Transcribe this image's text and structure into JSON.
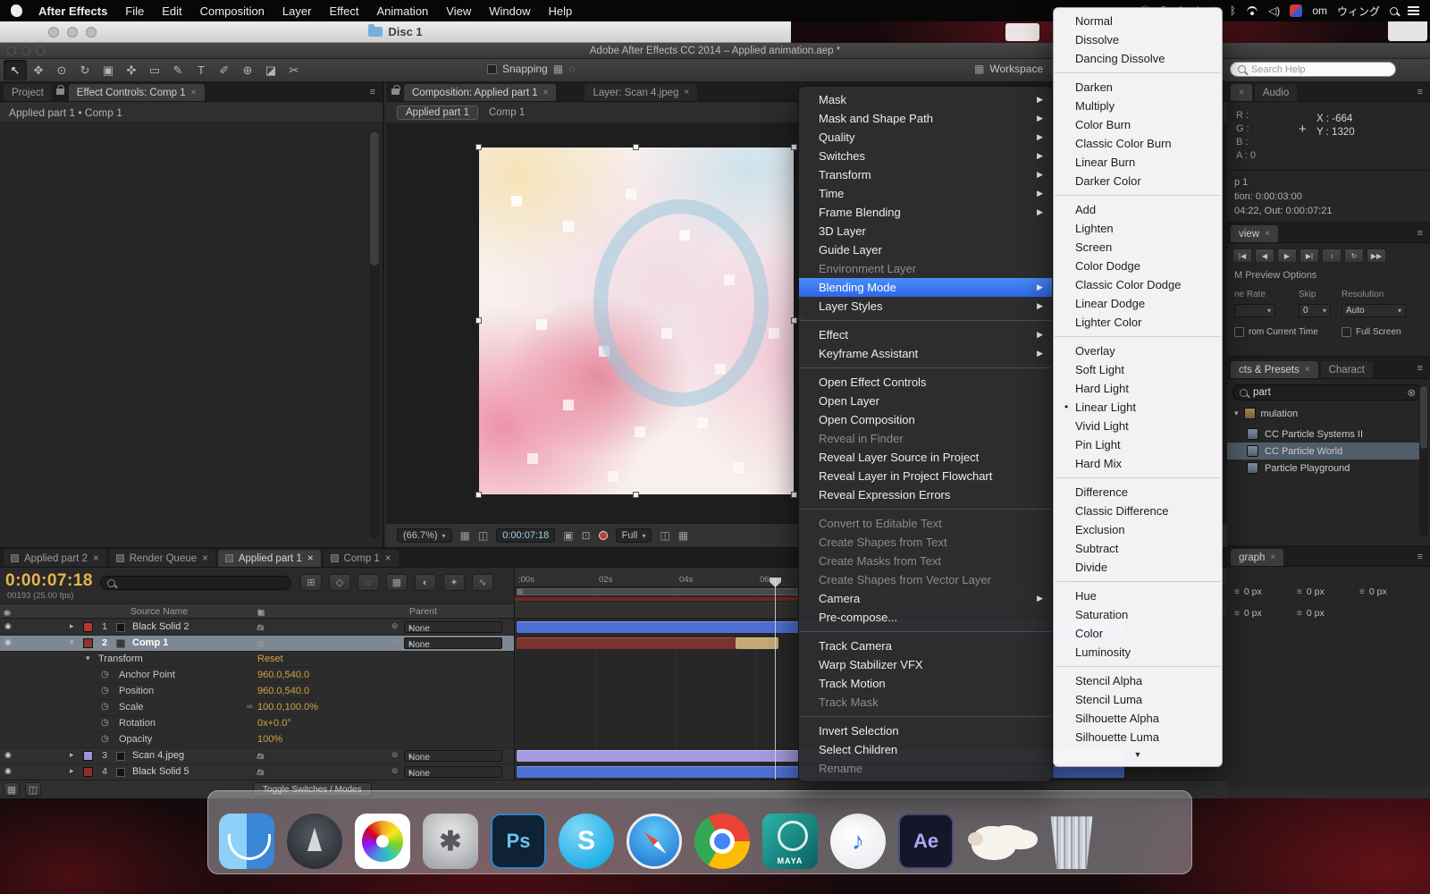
{
  "colors": {
    "menu_highlight": "#2c67e8",
    "value_text": "#d1a140",
    "timeline_timecode": "#e5b648",
    "comp_timecode": "#9fd0e8",
    "label_red": "#b03a30",
    "label_dark_red": "#8c2f2a",
    "label_purple": "#9e95d8",
    "selected_row": "#7e8893"
  },
  "icons": {
    "close": "×",
    "menu": "≡",
    "arrow_down": "▾",
    "arrow_right": "▸",
    "bullet": "•",
    "eye": "◉",
    "stopwatch": "◷",
    "link": "∞",
    "parent_link": "⊚",
    "clear": "⊗",
    "grid": "▦",
    "grid2": "◫",
    "camera": "▣",
    "snapshot": "⊡",
    "crumb_sep": "▸",
    "cross": "+",
    "scroll_down": "▼",
    "twirl_open": "▾",
    "twirl_closed": "▸",
    "comp_icon": "▣"
  },
  "menubar": {
    "app_name": "After Effects",
    "items": [
      {
        "label": "File"
      },
      {
        "label": "Edit"
      },
      {
        "label": "Composition"
      },
      {
        "label": "Layer"
      },
      {
        "label": "Effect"
      },
      {
        "label": "Animation"
      },
      {
        "label": "View"
      },
      {
        "label": "Window"
      },
      {
        "label": "Help"
      }
    ],
    "status": {
      "badge_1": "5",
      "badge_2": "1",
      "icon_sync": "↻",
      "icon_bt": "ᛒ",
      "text_fragment": "om",
      "ime_label": "ウィング"
    }
  },
  "finder_window": {
    "title": "Disc 1"
  },
  "ae_window": {
    "title": "Adobe After Effects CC 2014 – Applied animation.aep *"
  },
  "toolbar": {
    "tools": [
      {
        "_name": "selection-tool",
        "glyph": "↖",
        "active": true
      },
      {
        "_name": "hand-tool",
        "glyph": "✥"
      },
      {
        "_name": "zoom-tool",
        "glyph": "⊙"
      },
      {
        "_name": "rotation-tool",
        "glyph": "↻"
      },
      {
        "_name": "camera-tool",
        "glyph": "▣"
      },
      {
        "_name": "pan-behind-tool",
        "glyph": "✜"
      },
      {
        "_name": "shape-tool",
        "glyph": "▭"
      },
      {
        "_name": "pen-tool",
        "glyph": "✎"
      },
      {
        "_name": "type-tool",
        "glyph": "T"
      },
      {
        "_name": "brush-tool",
        "glyph": "✐"
      },
      {
        "_name": "clone-stamp-tool",
        "glyph": "⊕"
      },
      {
        "_name": "eraser-tool",
        "glyph": "◪"
      },
      {
        "_name": "roto-brush-tool",
        "glyph": "✂"
      }
    ],
    "snapping_label": "Snapping",
    "snap_icon_1": "▦",
    "snap_icon_2": "◌",
    "workspace_icon": "▦",
    "workspace_label": "Workspace",
    "search_help_placeholder": "Search Help"
  },
  "project_panel": {
    "tab_project": "Project",
    "tab_effect_controls": "Effect Controls: Comp 1",
    "breadcrumb": "Applied part 1 • Comp 1"
  },
  "comp_panel": {
    "tab_composition": "Composition: Applied part 1",
    "tab_layer": "Layer: Scan 4.jpeg",
    "crumb_comp": "Applied part 1",
    "crumb_parent": "Comp 1",
    "zoom_value": "(66.7%)",
    "timecode": "0:00:07:18",
    "resolution_value": "Full"
  },
  "context_menu": {
    "items": [
      {
        "label": "Mask",
        "submenu": true
      },
      {
        "label": "Mask and Shape Path",
        "submenu": true
      },
      {
        "label": "Quality",
        "submenu": true
      },
      {
        "label": "Switches",
        "submenu": true
      },
      {
        "label": "Transform",
        "submenu": true
      },
      {
        "label": "Time",
        "submenu": true
      },
      {
        "label": "Frame Blending",
        "submenu": true
      },
      {
        "label": "3D Layer"
      },
      {
        "label": "Guide Layer"
      },
      {
        "label": "Environment Layer",
        "disabled": true
      },
      {
        "label": "Blending Mode",
        "submenu": true,
        "highlighted": true,
        "_name": "context-menu-item-blending-mode"
      },
      {
        "label": "Layer Styles",
        "submenu": true
      },
      {
        "is_sep": true,
        "_name": "menu-separator",
        "_inter": false
      },
      {
        "label": "Effect",
        "submenu": true
      },
      {
        "label": "Keyframe Assistant",
        "submenu": true
      },
      {
        "is_sep": true,
        "_name": "menu-separator",
        "_inter": false
      },
      {
        "label": "Open Effect Controls"
      },
      {
        "label": "Open Layer"
      },
      {
        "label": "Open Composition"
      },
      {
        "label": "Reveal in Finder",
        "disabled": true
      },
      {
        "label": "Reveal Layer Source in Project"
      },
      {
        "label": "Reveal Layer in Project Flowchart"
      },
      {
        "label": "Reveal Expression Errors"
      },
      {
        "is_sep": true,
        "_name": "menu-separator",
        "_inter": false
      },
      {
        "label": "Convert to Editable Text",
        "disabled": true
      },
      {
        "label": "Create Shapes from Text",
        "disabled": true
      },
      {
        "label": "Create Masks from Text",
        "disabled": true
      },
      {
        "label": "Create Shapes from Vector Layer",
        "disabled": true
      },
      {
        "label": "Camera",
        "submenu": true
      },
      {
        "label": "Pre-compose..."
      },
      {
        "is_sep": true,
        "_name": "menu-separator",
        "_inter": false
      },
      {
        "label": "Track Camera"
      },
      {
        "label": "Warp Stabilizer VFX"
      },
      {
        "label": "Track Motion"
      },
      {
        "label": "Track Mask",
        "disabled": true
      },
      {
        "is_sep": true,
        "_name": "menu-separator",
        "_inter": false
      },
      {
        "label": "Invert Selection"
      },
      {
        "label": "Select Children"
      },
      {
        "label": "Rename",
        "disabled": true
      }
    ]
  },
  "blend_submenu": {
    "scroll_hint": "▼",
    "items": [
      {
        "label": "Normal"
      },
      {
        "label": "Dissolve"
      },
      {
        "label": "Dancing Dissolve"
      },
      {
        "is_sep": true,
        "_name": "menu-separator",
        "_inter": false
      },
      {
        "label": "Darken"
      },
      {
        "label": "Multiply"
      },
      {
        "label": "Color Burn"
      },
      {
        "label": "Classic Color Burn"
      },
      {
        "label": "Linear Burn"
      },
      {
        "label": "Darker Color"
      },
      {
        "is_sep": true,
        "_name": "menu-separator",
        "_inter": false
      },
      {
        "label": "Add"
      },
      {
        "label": "Lighten"
      },
      {
        "label": "Screen"
      },
      {
        "label": "Color Dodge"
      },
      {
        "label": "Classic Color Dodge"
      },
      {
        "label": "Linear Dodge"
      },
      {
        "label": "Lighter Color"
      },
      {
        "is_sep": true,
        "_name": "menu-separator",
        "_inter": false
      },
      {
        "label": "Overlay"
      },
      {
        "label": "Soft Light"
      },
      {
        "label": "Hard Light"
      },
      {
        "label": "Linear Light",
        "checked": true,
        "_name": "submenu-item-linear-light"
      },
      {
        "label": "Vivid Light"
      },
      {
        "label": "Pin Light"
      },
      {
        "label": "Hard Mix"
      },
      {
        "is_sep": true,
        "_name": "menu-separator",
        "_inter": false
      },
      {
        "label": "Difference"
      },
      {
        "label": "Classic Difference"
      },
      {
        "label": "Exclusion"
      },
      {
        "label": "Subtract"
      },
      {
        "label": "Divide"
      },
      {
        "is_sep": true,
        "_name": "menu-separator",
        "_inter": false
      },
      {
        "label": "Hue"
      },
      {
        "label": "Saturation"
      },
      {
        "label": "Color"
      },
      {
        "label": "Luminosity"
      },
      {
        "is_sep": true,
        "_name": "menu-separator",
        "_inter": false
      },
      {
        "label": "Stencil Alpha"
      },
      {
        "label": "Stencil Luma"
      },
      {
        "label": "Silhouette Alpha"
      },
      {
        "label": "Silhouette Luma"
      }
    ]
  },
  "info_panel": {
    "tab_audio": "Audio",
    "r_label": "R :",
    "g_label": "G :",
    "b_label": "B :",
    "a_label": "A : 0",
    "x_value": "X : -664",
    "y_value": "Y : 1320",
    "comp_line1": "p 1",
    "comp_line2": "tion: 0:00:03:00",
    "comp_line3": "04:22, Out: 0:00:07:21"
  },
  "preview_panel": {
    "tab_label": "view",
    "transport": [
      {
        "_name": "first-frame-button",
        "glyph": "|◀"
      },
      {
        "_name": "previous-frame-button",
        "glyph": "◀"
      },
      {
        "_name": "play-button",
        "glyph": "▶"
      },
      {
        "_name": "next-frame-button",
        "glyph": "▶|"
      },
      {
        "_name": "audio-toggle-button",
        "glyph": "♪"
      },
      {
        "_name": "loop-button",
        "glyph": "↻"
      },
      {
        "_name": "ram-preview-button",
        "glyph": "▶▶"
      }
    ],
    "options_title": "M Preview Options",
    "col_frame_rate": "ne Rate",
    "col_skip": "Skip",
    "col_resolution": "Resolution",
    "skip_value": "0",
    "resolution_value": "Auto",
    "check_from_current": "rom Current Time",
    "check_full_screen": "Full Screen"
  },
  "effects_panel": {
    "tab_effects": "cts & Presets",
    "tab_character": "Charact",
    "search_value": "part",
    "category": "mulation",
    "items": [
      {
        "label": "CC Particle Systems II",
        "_name": "effect-item-cc-particle-systems-ii"
      },
      {
        "label": "CC Particle World",
        "selected": true,
        "_name": "effect-item-cc-particle-world"
      },
      {
        "label": "Particle Playground",
        "_name": "effect-item-particle-playground"
      }
    ]
  },
  "paragraph_panel": {
    "tab_label": "graph",
    "fields_row1": [
      "0 px",
      "0 px",
      "0 px"
    ],
    "fields_row2": [
      "0 px",
      "0 px"
    ]
  },
  "timeline": {
    "tabs": [
      {
        "label": "Applied part 2",
        "_name": "tab-applied-part-2"
      },
      {
        "label": "Render Queue",
        "_name": "tab-render-queue"
      },
      {
        "label": "Applied part 1",
        "active": true,
        "_name": "tab-applied-part-1"
      },
      {
        "label": "Comp 1",
        "_name": "tab-comp-1"
      }
    ],
    "timecode": "0:00:07:18",
    "frame_info": "00193 (25.00 fps)",
    "header_buttons": [
      {
        "_name": "mini-flowchart-button",
        "glyph": "⊞"
      },
      {
        "_name": "draft-3d-button",
        "glyph": "◇"
      },
      {
        "_name": "hide-shy-layers-button",
        "glyph": "◌"
      },
      {
        "_name": "frame-blending-button",
        "glyph": "▦"
      },
      {
        "_name": "motion-blur-button",
        "glyph": "◐"
      },
      {
        "_name": "brainstorm-button",
        "glyph": "✦"
      },
      {
        "_name": "graph-editor-button",
        "glyph": "∿"
      }
    ],
    "av_icons": [
      "◉",
      "♪",
      "○",
      "▭"
    ],
    "switch_header_icons": [
      "✦",
      "fx",
      "▦",
      "◐",
      "○"
    ],
    "switch_glyphs": [
      "⊙",
      "∕",
      "fx"
    ],
    "col_source_name": "Source Name",
    "col_parent": "Parent",
    "ruler_labels": [
      ":00s",
      "02s",
      "04s",
      "06s"
    ],
    "layers": [
      {
        "index": "1",
        "name": "Black Solid 2",
        "parent": "None"
      },
      {
        "index": "2",
        "name": "Comp 1",
        "parent": "None",
        "selected": true
      },
      {
        "index": "3",
        "name": "Scan 4.jpeg",
        "parent": "None"
      },
      {
        "index": "4",
        "name": "Black Solid 5",
        "parent": "None"
      }
    ],
    "transform": {
      "group_label": "Transform",
      "reset_label": "Reset",
      "props": [
        {
          "label": "Anchor Point",
          "value": "960.0,540.0"
        },
        {
          "label": "Position",
          "value": "960.0,540.0"
        },
        {
          "label": "Scale",
          "value": "100.0,100.0%",
          "linked": true
        },
        {
          "label": "Rotation",
          "value": "0x+0.0°"
        },
        {
          "label": "Opacity",
          "value": "100%"
        }
      ]
    },
    "toggle_button": "Toggle Switches / Modes"
  },
  "dock": {
    "items": [
      {
        "_name": "dock-finder-icon",
        "cls": "dk-finder"
      },
      {
        "_name": "dock-launchpad-icon",
        "cls": "dk-launchpad"
      },
      {
        "_name": "dock-photos-icon",
        "cls": "dk-photos"
      },
      {
        "_name": "dock-system-preferences-icon",
        "cls": "dk-prefs",
        "text": "✱"
      },
      {
        "_name": "dock-photoshop-icon",
        "cls": "dk-ps",
        "text": "Ps"
      },
      {
        "_name": "dock-skype-icon",
        "cls": "dk-skype",
        "text": "S"
      },
      {
        "_name": "dock-safari-icon",
        "cls": "dk-safari"
      },
      {
        "_name": "dock-chrome-icon",
        "cls": "dk-chrome"
      },
      {
        "_name": "dock-maya-icon",
        "cls": "dk-maya",
        "text": "MAYA"
      },
      {
        "_name": "dock-itunes-icon",
        "cls": "dk-itunes",
        "text": "♪"
      },
      {
        "_name": "dock-after-effects-icon",
        "cls": "dk-ae",
        "text": "Ae"
      },
      {
        "_name": "dock-sheep-icon",
        "cls": "dk-sheep"
      },
      {
        "_name": "dock-trash-icon",
        "cls": "dk-trash",
        "sep": true
      }
    ]
  }
}
